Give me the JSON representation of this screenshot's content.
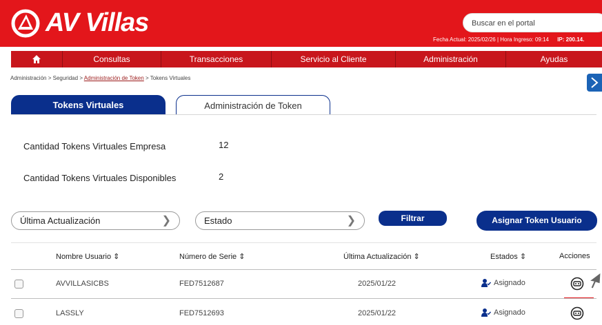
{
  "header": {
    "brand": "AV Villas",
    "search_placeholder": "Buscar en el portal",
    "session_info": "Fecha Actual: 2025/02/26 | Hora Ingreso: 09:14",
    "ip": "IP: 200.14."
  },
  "nav": {
    "home_icon": "home-icon",
    "items": [
      {
        "label": "Consultas"
      },
      {
        "label": "Transacciones"
      },
      {
        "label": "Servicio al Cliente"
      },
      {
        "label": "Administración"
      },
      {
        "label": "Ayudas"
      }
    ]
  },
  "breadcrumb": {
    "item1": "Administración",
    "item2": "Seguridad",
    "item3": "Administración de Token",
    "item4": "Tokens Virtuales",
    "separator": ">"
  },
  "tabs": {
    "active": "Tokens Virtuales",
    "inactive": "Administración de Token"
  },
  "stats": {
    "empresa_label": "Cantidad Tokens Virtuales Empresa",
    "empresa_value": "12",
    "disponibles_label": "Cantidad Tokens Virtuales Disponibles",
    "disponibles_value": "2"
  },
  "filters": {
    "ultima_actualizacion": "Última Actualización",
    "estado": "Estado",
    "filtrar_button": "Filtrar",
    "asignar_button": "Asignar Token Usuario"
  },
  "table": {
    "headers": {
      "nombre": "Nombre Usuario",
      "serie": "Número de Serie",
      "actualizacion": "Última Actualización",
      "estados": "Estados",
      "acciones": "Acciones"
    },
    "sort_glyph": "⇕",
    "rows": [
      {
        "nombre": "AVVILLASICBS",
        "serie": "FED7512687",
        "fecha": "2025/01/22",
        "estado": "Asignado"
      },
      {
        "nombre": "LASSLY",
        "serie": "FED7512693",
        "fecha": "2025/01/22",
        "estado": "Asignado"
      }
    ]
  },
  "colors": {
    "brand_red": "#e3161b",
    "primary_blue": "#0a2f8c"
  }
}
